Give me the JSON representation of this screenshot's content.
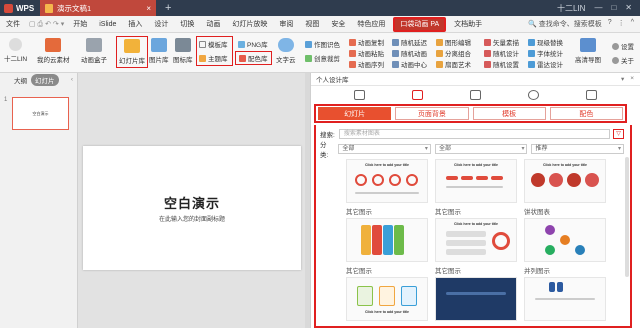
{
  "titlebar": {
    "app": "WPS",
    "doc_tab": "演示文稿1",
    "add_tab": "+",
    "user": "十二LIN",
    "window_controls": [
      "—",
      "□",
      "✕"
    ]
  },
  "menubar": {
    "file": "文件",
    "items": [
      "开始",
      "iSlide",
      "插入",
      "设计",
      "切换",
      "动画",
      "幻灯片放映",
      "审阅",
      "视图",
      "安全",
      "特色应用"
    ],
    "active": "口袋动画 PA",
    "after": "文档助手",
    "search": "查找命令、搜索模板",
    "help": "?"
  },
  "ribbon": {
    "account": "十二LIN",
    "cloud": "我的云素材",
    "anim_box": "动画盒子",
    "slide_lib": "幻灯片库",
    "image_lib": "图片库",
    "icon_lib": "图标库",
    "template_lib": "模板库",
    "theme_lib": "主题库",
    "png_lib": "PNG库",
    "color_lib": "配色库",
    "text_cloud": "文字云",
    "author_color": "作图识色",
    "creative_drop": "创意裁剪",
    "anim_group": [
      "动画复制",
      "动画粘贴",
      "动画序列"
    ],
    "random_group": [
      "随机延迟",
      "随机动画",
      "动画中心"
    ],
    "shape_group": [
      "图形编辑",
      "分离组合",
      "扇面艺术"
    ],
    "vector_group": [
      "矢量素描",
      "随机设计",
      "随机设置"
    ],
    "adv_group": [
      "现级替换",
      "字体统计",
      "雷达设计"
    ],
    "hq": "高清导图",
    "right_group": [
      "设置",
      "关于"
    ]
  },
  "leftpane": {
    "tabs": [
      "大纲",
      "幻灯片"
    ],
    "active_tab": "幻灯片",
    "slide_number": "1",
    "thumb_title": "空白演示"
  },
  "slide": {
    "title": "空白演示",
    "subtitle": "在此输入您的封面副标题"
  },
  "design_panel": {
    "header": "个人设计库",
    "tabs": [
      "幻灯片",
      "页面背景",
      "模板",
      "配色"
    ],
    "active_tab": "幻灯片",
    "search_label": "搜索:",
    "search_placeholder": "搜索素材图表",
    "category_label": "分类:",
    "category_values": [
      "全部",
      "全部",
      "推荐"
    ],
    "card_title_text": "Click here to add your title",
    "cards": [
      {
        "label": "其它图示"
      },
      {
        "label": "其它图示"
      },
      {
        "label": "饼状图表"
      },
      {
        "label": "其它图示"
      },
      {
        "label": "其它图示"
      },
      {
        "label": "并列图示"
      },
      {
        "label": ""
      },
      {
        "label": ""
      },
      {
        "label": ""
      }
    ]
  },
  "colors": {
    "accent": "#e8502f",
    "highlight": "#e02020",
    "titlebar": "#2f3c4e"
  }
}
